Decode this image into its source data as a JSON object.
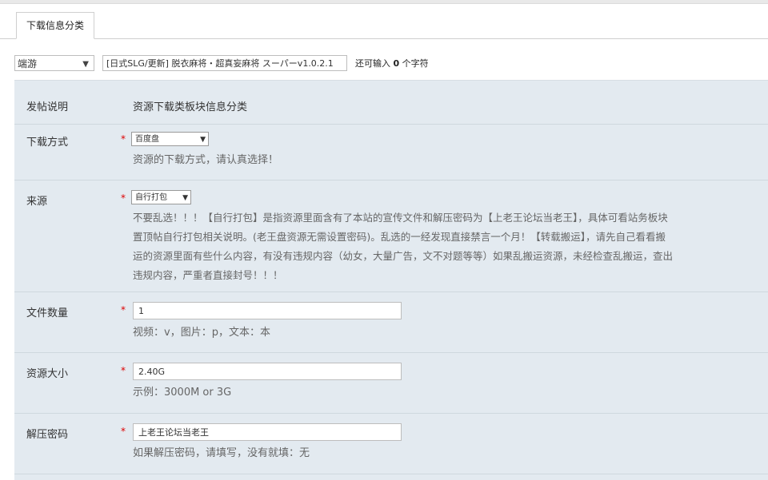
{
  "tab": {
    "label": "下载信息分类"
  },
  "toolbar": {
    "category_value": "端游",
    "title_value": "[日式SLG/更新] 脱衣麻将・超真妄麻将 スーパーv1.0.2.1",
    "char_tip_prefix": "还可输入",
    "char_tip_count": "0",
    "char_tip_suffix": "个字符"
  },
  "form": {
    "post_note": {
      "label": "发帖说明",
      "value": "资源下载类板块信息分类"
    },
    "download_method": {
      "label": "下载方式",
      "selected": "百度盘",
      "hint": "资源的下载方式，请认真选择！"
    },
    "source": {
      "label": "来源",
      "selected": "自行打包",
      "hint_lines": [
        "不要乱选！！！【自行打包】是指资源里面含有了本站的宣传文件和解压密码为【上老王论坛当老王】，具体可看站务板块",
        "置顶帖自行打包相关说明。(老王盘资源无需设置密码)。乱选的一经发现直接禁言一个月！【转载搬运】，请先自己看看搬",
        "运的资源里面有些什么内容，有没有违规内容（幼女，大量广告，文不对题等等）如果乱搬运资源，未经检查乱搬运，查出",
        "违规内容，严重者直接封号！！！"
      ]
    },
    "file_count": {
      "label": "文件数量",
      "value": "1",
      "hint": "视频：v，图片：p，文本：本"
    },
    "file_size": {
      "label": "资源大小",
      "value": "2.40G",
      "hint": "示例：3000M or 3G"
    },
    "unzip_password": {
      "label": "解压密码",
      "value": "上老王论坛当老王",
      "hint": "如果解压密码，请填写，没有就填：无"
    }
  },
  "required_mark": "*",
  "icons": {
    "select_caret": "chevron-down-icon"
  }
}
